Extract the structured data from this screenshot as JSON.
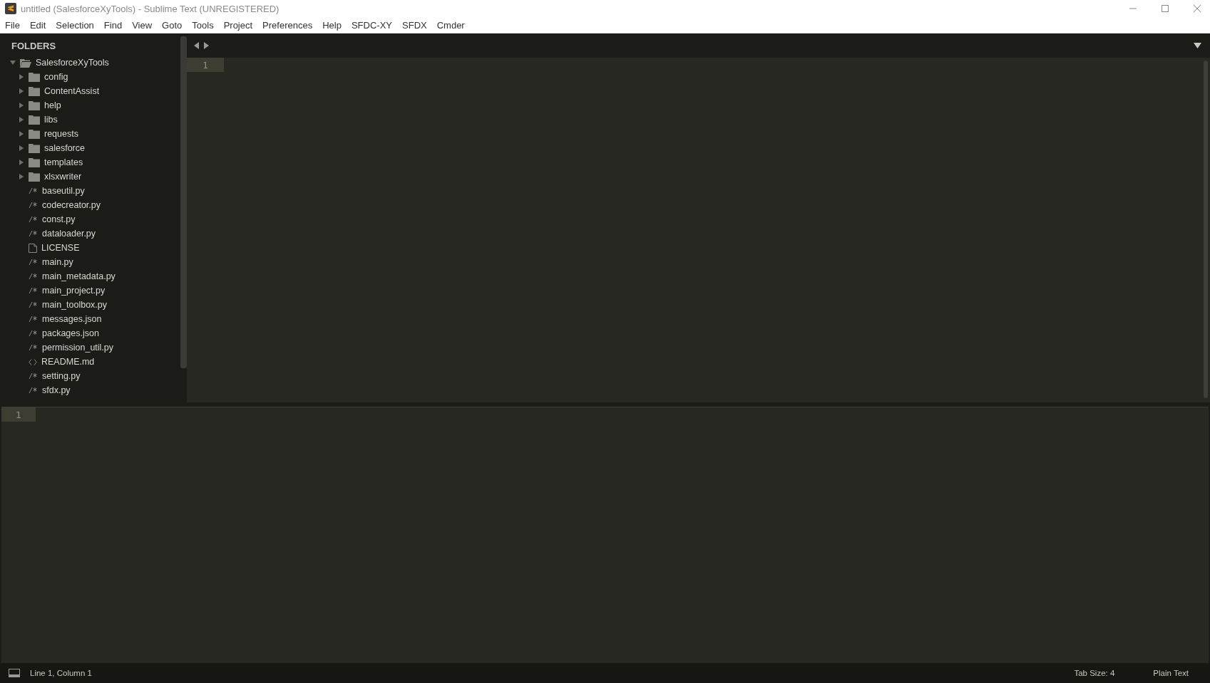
{
  "window": {
    "title": "untitled (SalesforceXyTools) - Sublime Text (UNREGISTERED)"
  },
  "menu": [
    "File",
    "Edit",
    "Selection",
    "Find",
    "View",
    "Goto",
    "Tools",
    "Project",
    "Preferences",
    "Help",
    "SFDC-XY",
    "SFDX",
    "Cmder"
  ],
  "sidebar": {
    "heading": "FOLDERS",
    "tree": [
      {
        "label": "SalesforceXyTools",
        "kind": "folder",
        "expanded": true,
        "children": [
          {
            "label": "config",
            "kind": "folder",
            "expanded": false
          },
          {
            "label": "ContentAssist",
            "kind": "folder",
            "expanded": false
          },
          {
            "label": "help",
            "kind": "folder",
            "expanded": false
          },
          {
            "label": "libs",
            "kind": "folder",
            "expanded": false
          },
          {
            "label": "requests",
            "kind": "folder",
            "expanded": false
          },
          {
            "label": "salesforce",
            "kind": "folder",
            "expanded": false
          },
          {
            "label": "templates",
            "kind": "folder",
            "expanded": false
          },
          {
            "label": "xlsxwriter",
            "kind": "folder",
            "expanded": false
          },
          {
            "label": "baseutil.py",
            "kind": "code"
          },
          {
            "label": "codecreator.py",
            "kind": "code"
          },
          {
            "label": "const.py",
            "kind": "code"
          },
          {
            "label": "dataloader.py",
            "kind": "code"
          },
          {
            "label": "LICENSE",
            "kind": "text"
          },
          {
            "label": "main.py",
            "kind": "code"
          },
          {
            "label": "main_metadata.py",
            "kind": "code"
          },
          {
            "label": "main_project.py",
            "kind": "code"
          },
          {
            "label": "main_toolbox.py",
            "kind": "code"
          },
          {
            "label": "messages.json",
            "kind": "code"
          },
          {
            "label": "packages.json",
            "kind": "code"
          },
          {
            "label": "permission_util.py",
            "kind": "code"
          },
          {
            "label": "README.md",
            "kind": "markup"
          },
          {
            "label": "setting.py",
            "kind": "code"
          },
          {
            "label": "sfdx.py",
            "kind": "code"
          }
        ]
      }
    ]
  },
  "editor": {
    "line_numbers": [
      "1"
    ]
  },
  "output_panel": {
    "line_numbers": [
      "1"
    ]
  },
  "status_bar": {
    "position": "Line 1, Column 1",
    "tab_size": "Tab Size: 4",
    "syntax": "Plain Text"
  }
}
